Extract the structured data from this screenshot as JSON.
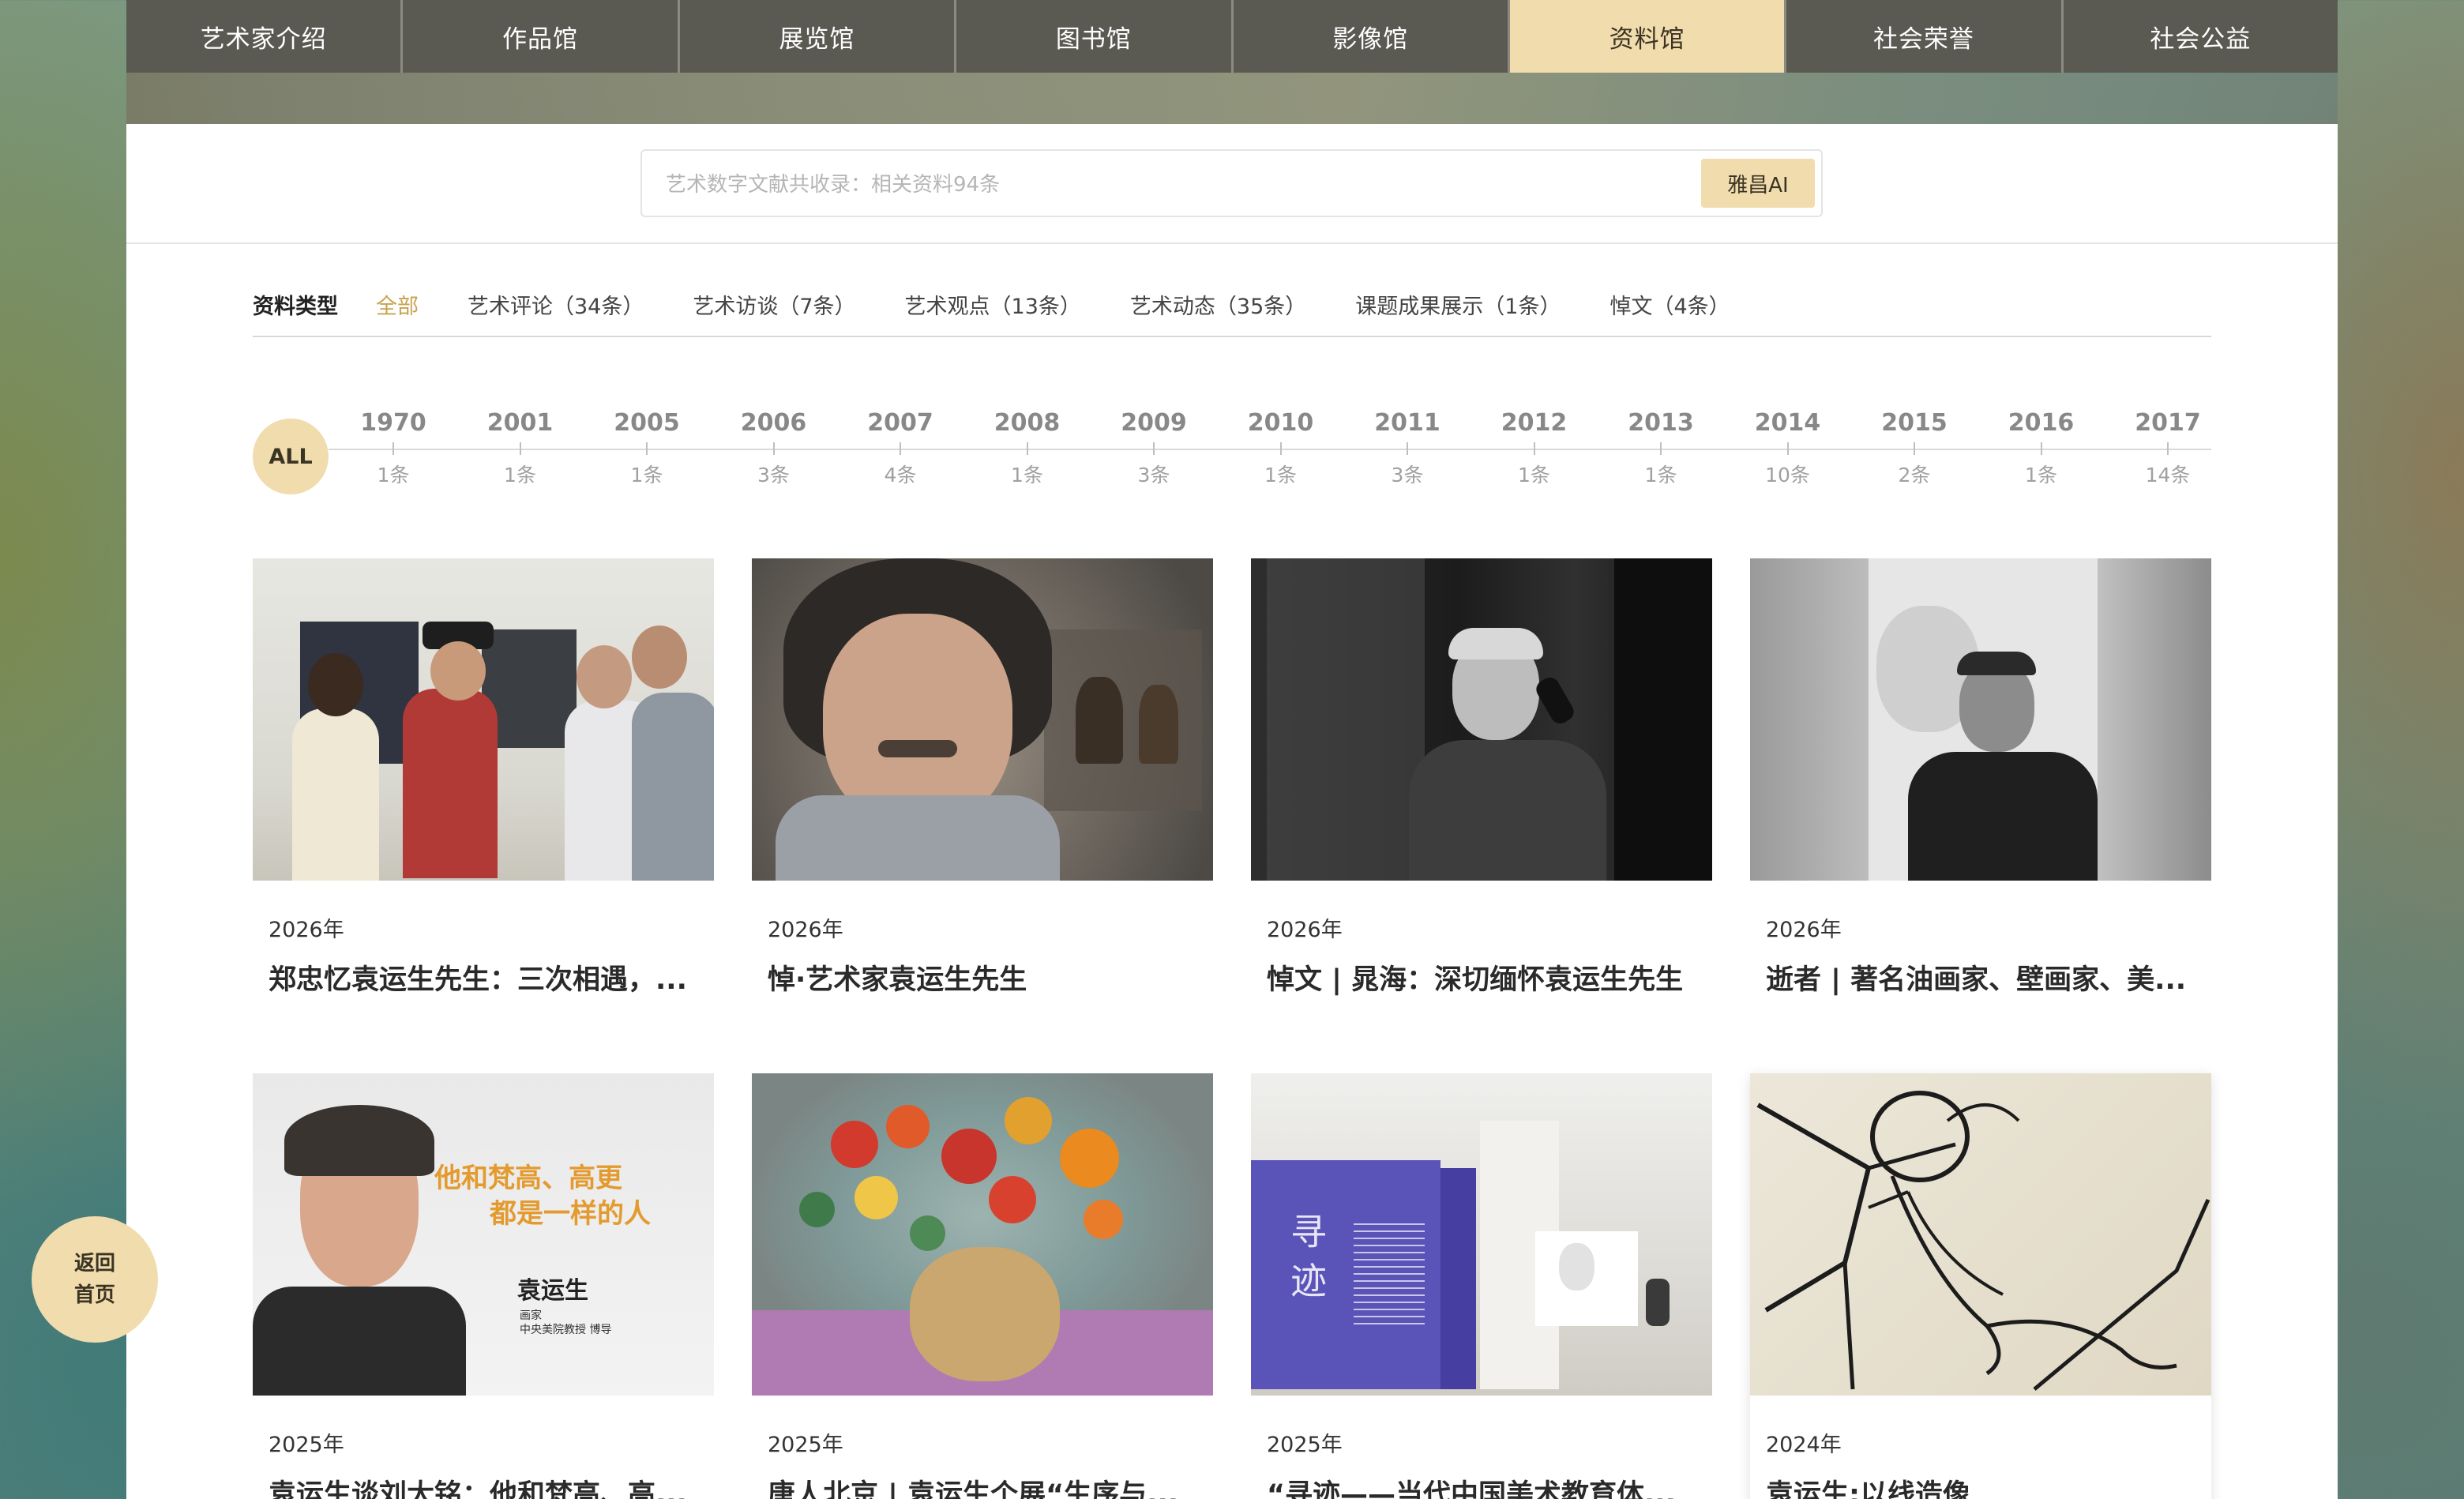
{
  "nav": {
    "items": [
      {
        "label": "艺术家介绍",
        "active": false
      },
      {
        "label": "作品馆",
        "active": false
      },
      {
        "label": "展览馆",
        "active": false
      },
      {
        "label": "图书馆",
        "active": false
      },
      {
        "label": "影像馆",
        "active": false
      },
      {
        "label": "资料馆",
        "active": true
      },
      {
        "label": "社会荣誉",
        "active": false
      },
      {
        "label": "社会公益",
        "active": false
      }
    ]
  },
  "search": {
    "placeholder": "艺术数字文献共收录：相关资料94条",
    "button_label": "雅昌AI"
  },
  "filter": {
    "label": "资料类型",
    "types": [
      {
        "label": "全部",
        "active": true
      },
      {
        "label": "艺术评论（34条）",
        "active": false
      },
      {
        "label": "艺术访谈（7条）",
        "active": false
      },
      {
        "label": "艺术观点（13条）",
        "active": false
      },
      {
        "label": "艺术动态（35条）",
        "active": false
      },
      {
        "label": "课题成果展示（1条）",
        "active": false
      },
      {
        "label": "悼文（4条）",
        "active": false
      }
    ]
  },
  "timeline": {
    "all_label": "ALL",
    "years": [
      {
        "year": "1970",
        "count": "1条"
      },
      {
        "year": "2001",
        "count": "1条"
      },
      {
        "year": "2005",
        "count": "1条"
      },
      {
        "year": "2006",
        "count": "3条"
      },
      {
        "year": "2007",
        "count": "4条"
      },
      {
        "year": "2008",
        "count": "1条"
      },
      {
        "year": "2009",
        "count": "3条"
      },
      {
        "year": "2010",
        "count": "1条"
      },
      {
        "year": "2011",
        "count": "3条"
      },
      {
        "year": "2012",
        "count": "1条"
      },
      {
        "year": "2013",
        "count": "1条"
      },
      {
        "year": "2014",
        "count": "10条"
      },
      {
        "year": "2015",
        "count": "2条"
      },
      {
        "year": "2016",
        "count": "1条"
      },
      {
        "year": "2017",
        "count": "14条"
      }
    ]
  },
  "cards": [
    {
      "date": "2026年",
      "title": "郑忠忆袁运生先生：三次相遇，..."
    },
    {
      "date": "2026年",
      "title": "悼·艺术家袁运生先生"
    },
    {
      "date": "2026年",
      "title": "悼文 | 晁海：深切缅怀袁运生先生"
    },
    {
      "date": "2026年",
      "title": "逝者 | 著名油画家、壁画家、美..."
    },
    {
      "date": "2025年",
      "title": "袁运生谈刘大铭：他和梵高、高..."
    },
    {
      "date": "2025年",
      "title": "唐人北京 | 袁运生个展“生序与..."
    },
    {
      "date": "2025年",
      "title": "“寻迹——当代中国美术教育体..."
    },
    {
      "date": "2024年",
      "title": "袁运生:以线造像"
    }
  ],
  "thumb5": {
    "headline_line1": "他和梵高、高更",
    "headline_line2": "都是一样的人",
    "name": "袁运生",
    "role": "画家",
    "affiliation": "中央美院教授 博导"
  },
  "thumb7": {
    "sign_title": "寻迹"
  },
  "back_home": {
    "line1": "返回",
    "line2": "首页"
  }
}
